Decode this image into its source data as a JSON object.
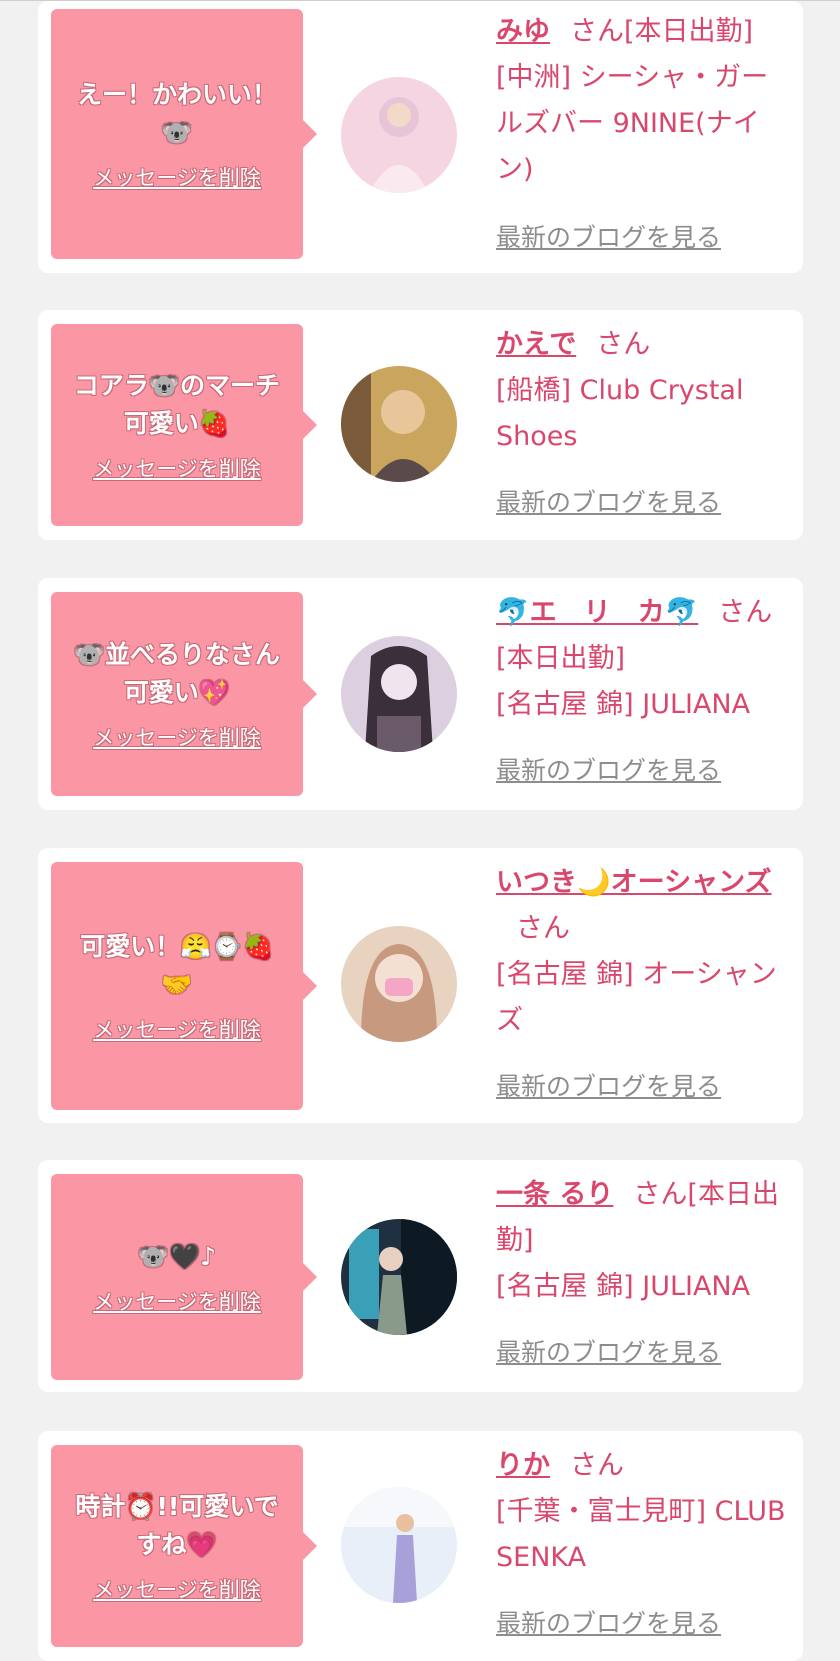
{
  "cards": [
    {
      "message": "えー！かわいい！🐨",
      "delete_label": "メッセージを削除",
      "name": "みゆ",
      "honorific": "さん[本日出勤]",
      "shop": "[中洲] シーシャ・ガールズバー 9NINE(ナイン)",
      "blog_link": "最新のブログを見る",
      "avatar_colors": [
        "#f6d5e3",
        "#e8c4d8",
        "#fbe9f0"
      ]
    },
    {
      "message": "コアラ🐨のマーチ可愛い🍓",
      "delete_label": "メッセージを削除",
      "name": "かえで",
      "honorific": "さん",
      "shop": "[船橋] Club Crystal Shoes",
      "blog_link": "最新のブログを見る",
      "avatar_colors": [
        "#c9a55e",
        "#7a5a3a",
        "#e8c69a"
      ]
    },
    {
      "message": "🐨並べるりなさん可愛い💖",
      "delete_label": "メッセージを削除",
      "name": "🐬エ　リ　カ🐬",
      "honorific": "さん[本日出勤]",
      "shop": "[名古屋 錦] JULIANA",
      "blog_link": "最新のブログを見る",
      "avatar_colors": [
        "#dcd0e0",
        "#3a2f3a",
        "#f0e4ee"
      ]
    },
    {
      "message": "可愛い！😤⌚🍓🤝",
      "delete_label": "メッセージを削除",
      "name": "いつき🌙オーシャンズ",
      "honorific": "さん",
      "shop": "[名古屋 錦] オーシャンズ",
      "blog_link": "最新のブログを見る",
      "avatar_colors": [
        "#e8d2c0",
        "#c79a80",
        "#f3e0d2"
      ]
    },
    {
      "message": "🐨🖤♪",
      "delete_label": "メッセージを削除",
      "name": "一条 るり",
      "honorific": "さん[本日出勤]",
      "shop": "[名古屋 錦] JULIANA",
      "blog_link": "最新のブログを見る",
      "avatar_colors": [
        "#1f3040",
        "#3aa0b8",
        "#0d1a24"
      ]
    },
    {
      "message": "時計⏰!!可愛いですね💗",
      "delete_label": "メッセージを削除",
      "name": "りか",
      "honorific": "さん",
      "shop": "[千葉・富士見町] CLUB SENKA",
      "blog_link": "最新のブログを見る",
      "avatar_colors": [
        "#e8eff8",
        "#a8a0d8",
        "#f6f8fc"
      ]
    }
  ]
}
